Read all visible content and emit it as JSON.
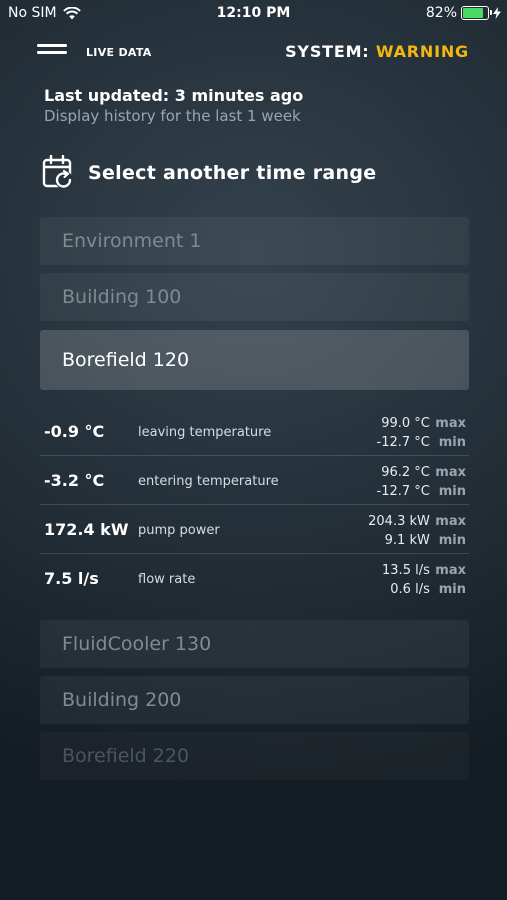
{
  "status_bar": {
    "carrier": "No SIM",
    "time": "12:10 PM",
    "battery": "82%",
    "battery_level": 0.82
  },
  "header": {
    "title": "LIVE DATA",
    "system_label": "SYSTEM:",
    "system_status": "WARNING",
    "status_color": "#f2b80f"
  },
  "updated": "Last updated: 3 minutes ago",
  "history": "Display history for the last 1 week",
  "time_range_label": "Select another time range",
  "items_top": [
    {
      "label": "Environment 1"
    },
    {
      "label": "Building 100"
    },
    {
      "label": "Borefield 120"
    }
  ],
  "metrics": [
    {
      "value": "-0.9 °C",
      "label": "leaving temperature",
      "max": "99.0 °C",
      "min": "-12.7 °C"
    },
    {
      "value": "-3.2 °C",
      "label": "entering temperature",
      "max": "96.2 °C",
      "min": "-12.7 °C"
    },
    {
      "value": "172.4 kW",
      "label": "pump power",
      "max": "204.3 kW",
      "min": "9.1 kW"
    },
    {
      "value": "7.5 l/s",
      "label": "flow rate",
      "max": "13.5 l/s",
      "min": "0.6 l/s"
    }
  ],
  "max_tag": "max",
  "min_tag": "min",
  "items_bottom": [
    {
      "label": "FluidCooler 130"
    },
    {
      "label": "Building 200"
    },
    {
      "label": "Borefield 220"
    }
  ]
}
